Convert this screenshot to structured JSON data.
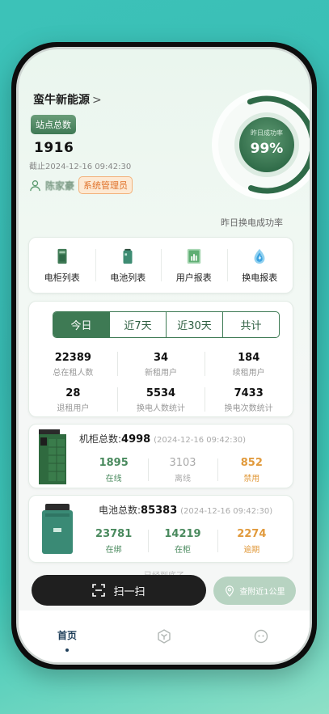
{
  "header": {
    "brand": "蛮牛新能源",
    "brand_chevron": ">",
    "site_badge": "站点总数",
    "site_count": "1916",
    "as_of": "截止2024-12-16 09:42:30",
    "user_name": "陈家豪",
    "role": "系统管理员"
  },
  "gauge": {
    "label": "昨日成功率",
    "value_text": "99%",
    "value": 0.99,
    "caption": "昨日换电成功率",
    "color": "#2f6a48"
  },
  "menu": [
    {
      "label": "电柜列表",
      "icon": "cabinet-icon"
    },
    {
      "label": "电池列表",
      "icon": "battery-icon"
    },
    {
      "label": "用户报表",
      "icon": "user-report-icon"
    },
    {
      "label": "换电报表",
      "icon": "swap-report-icon"
    }
  ],
  "stats": {
    "tabs": [
      "今日",
      "近7天",
      "近30天",
      "共计"
    ],
    "active_tab": 0,
    "rows": [
      [
        {
          "value": "22389",
          "label": "总在租人数"
        },
        {
          "value": "34",
          "label": "新租用户"
        },
        {
          "value": "184",
          "label": "续租用户"
        }
      ],
      [
        {
          "value": "28",
          "label": "退租用户"
        },
        {
          "value": "5534",
          "label": "换电人数统计"
        },
        {
          "value": "7433",
          "label": "换电次数统计"
        }
      ]
    ]
  },
  "cabinet": {
    "title": "机柜总数:",
    "total": "4998",
    "time": "(2024-12-16 09:42:30)",
    "items": [
      {
        "value": "1895",
        "label": "在线"
      },
      {
        "value": "3103",
        "label": "离线"
      },
      {
        "value": "852",
        "label": "禁用"
      }
    ]
  },
  "battery": {
    "title": "电池总数:",
    "total": "85383",
    "time": "(2024-12-16 09:42:30)",
    "items": [
      {
        "value": "23781",
        "label": "在绑"
      },
      {
        "value": "14219",
        "label": "在柜"
      },
      {
        "value": "2274",
        "label": "逾期"
      }
    ]
  },
  "footer": {
    "loaded_text": "已经到底了",
    "scan_label": "扫一扫",
    "nearby_label": "查附近1公里"
  },
  "tabbar": {
    "home": "首页"
  }
}
